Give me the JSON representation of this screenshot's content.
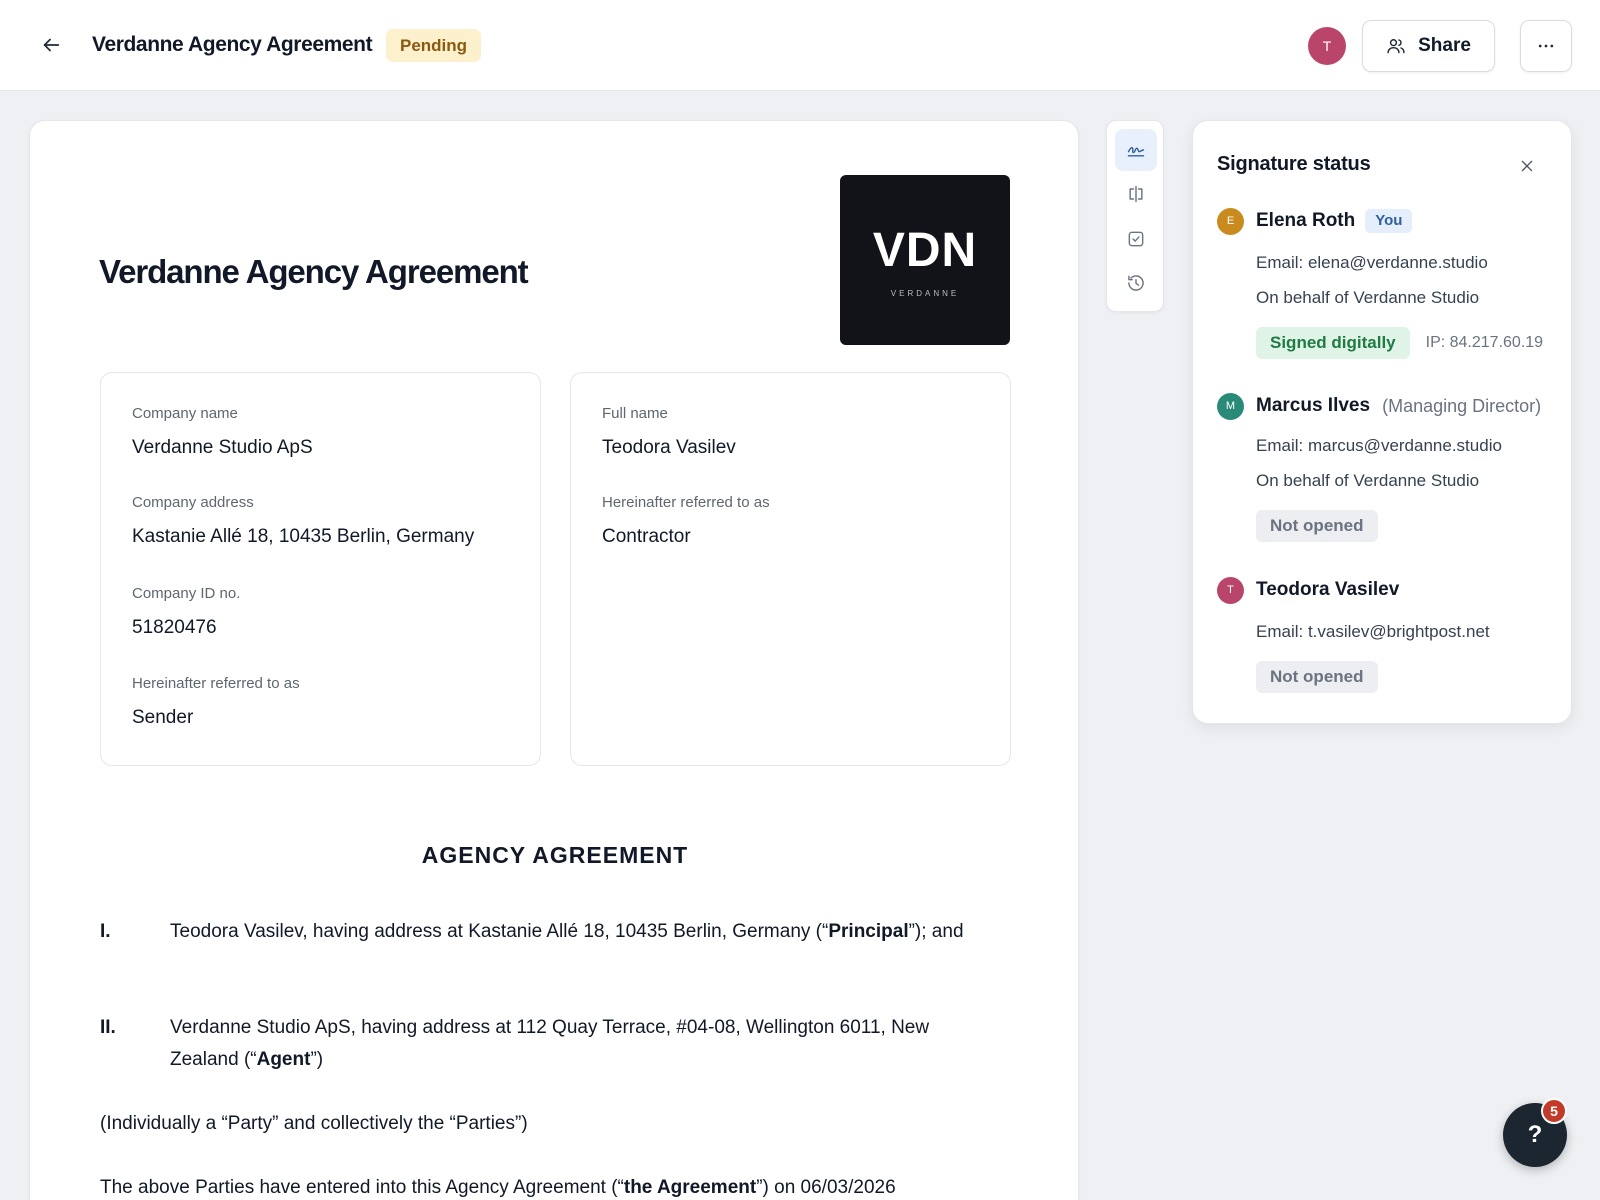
{
  "header": {
    "title": "Verdanne Agency Agreement",
    "status": "Pending",
    "avatar_initial": "T",
    "share_label": "Share"
  },
  "document": {
    "title": "Verdanne Agency Agreement",
    "logo": {
      "mark": "VDN",
      "sub": "VERDANNE"
    },
    "sender": {
      "company_name_label": "Company name",
      "company_name": "Verdanne Studio ApS",
      "company_address_label": "Company address",
      "company_address": "Kastanie Allé 18, 10435 Berlin, Germany",
      "company_id_label": "Company ID no.",
      "company_id": "51820476",
      "referred_label": "Hereinafter referred to as",
      "referred_as": "Sender"
    },
    "recipient": {
      "full_name_label": "Full name",
      "full_name": "Teodora Vasilev",
      "referred_label": "Hereinafter referred to as",
      "referred_as": "Contractor"
    },
    "heading": "AGENCY AGREEMENT",
    "clauses": [
      {
        "num": "I.",
        "text_before": "Teodora Vasilev, having address at Kastanie Allé 18, 10435 Berlin, Germany (“",
        "bold": "Principal",
        "text_after": "”); and"
      },
      {
        "num": "II.",
        "text_before": "Verdanne Studio ApS, having address at 112 Quay Terrace, #04-08, Wellington 6011, New Zealand (“",
        "bold": "Agent",
        "text_after": "”)"
      }
    ],
    "parties_note": "(Individually a “Party” and collectively the “Parties”)",
    "entered": {
      "text_before": "The above Parties have entered into this Agency Agreement (“",
      "bold": "the Agreement",
      "text_after": "”) on 06/03/2026"
    }
  },
  "signature_panel": {
    "title": "Signature status",
    "signers": [
      {
        "initial": "E",
        "name": "Elena Roth",
        "badge": "You",
        "email": "Email: elena@verdanne.studio",
        "behalf": "On behalf of Verdanne Studio",
        "status": "Signed digitally",
        "ip": "IP: 84.217.60.19",
        "color": "#c98a1e"
      },
      {
        "initial": "M",
        "name": "Marcus Ilves",
        "role": "(Managing Director)",
        "email": "Email: marcus@verdanne.studio",
        "behalf": "On behalf of Verdanne Studio",
        "status": "Not opened",
        "color": "#2a8a78"
      },
      {
        "initial": "T",
        "name": "Teodora Vasilev",
        "email": "Email: t.vasilev@brightpost.net",
        "status": "Not opened",
        "color": "#b9466a"
      }
    ]
  },
  "help": {
    "label": "?",
    "count": "5"
  },
  "colors": {
    "pending_bg": "#fdf0cc",
    "signed_bg": "#dff3e6",
    "accent": "#2f5f9e"
  }
}
